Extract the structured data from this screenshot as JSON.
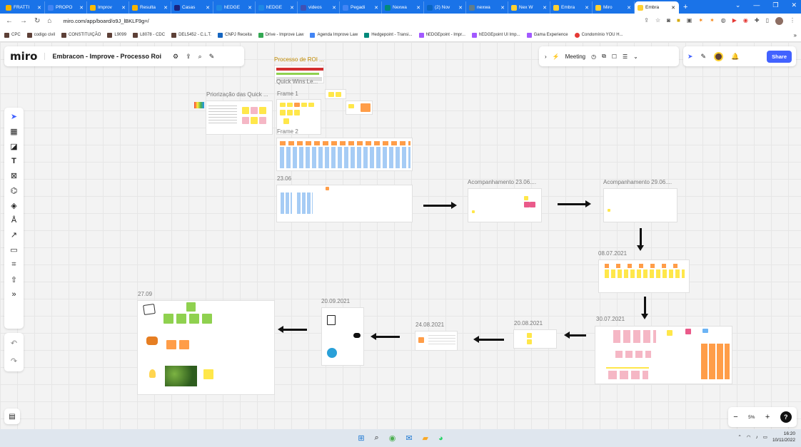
{
  "browser": {
    "tabs": [
      {
        "label": "FRATTI",
        "color": "#f4b400"
      },
      {
        "label": "PROPO",
        "color": "#4285f4"
      },
      {
        "label": "Improv",
        "color": "#fbbc04"
      },
      {
        "label": "Resulta",
        "color": "#f4b400"
      },
      {
        "label": "Casas",
        "color": "#1a237e"
      },
      {
        "label": "hEDGE",
        "color": "#1e88e5"
      },
      {
        "label": "hEDGE",
        "color": "#1e88e5"
      },
      {
        "label": "videos",
        "color": "#3f51b5"
      },
      {
        "label": "Pegadi",
        "color": "#4285f4"
      },
      {
        "label": "Nexwa",
        "color": "#00897b"
      },
      {
        "label": "(2) Nov",
        "color": "#0a66c2"
      },
      {
        "label": "nexwa",
        "color": "#607d8b"
      },
      {
        "label": "Nex W",
        "color": "#ffd02f"
      },
      {
        "label": "Embra",
        "color": "#ffd02f"
      },
      {
        "label": "Miro",
        "color": "#ffd02f"
      },
      {
        "label": "Embra",
        "color": "#ffd02f"
      }
    ],
    "url": "miro.com/app/board/o9J_lBKLF9g=/",
    "bookmarks": [
      "CPC",
      "codigo civil",
      "CONSTITUIÇÃO",
      "L9099",
      "L8078 - CDC",
      "DEL5452 - C.L.T.",
      "CNPJ Receita",
      "Drive - Improve Law",
      "Agenda Improve Law",
      "Hedgepoint - Transi...",
      "hEDGEpoint - Impr...",
      "hEDGEpoint UI Imp...",
      "Gama Experience",
      "Condomínio YOU H..."
    ]
  },
  "board": {
    "logo": "miro",
    "name": "Embracon - Improve - Processo Roi",
    "meeting_label": "Meeting",
    "share_label": "Share",
    "zoom": "5%"
  },
  "frames": {
    "processo": "Processo de ROI ...",
    "quickwins": "Quick Wins Le...",
    "priorizacao": "Priorização das Quick ...",
    "frame1": "Frame 1",
    "frame2": "Frame 2",
    "f2306": "23.06",
    "acomp2306": "Acompanhamento 23.06....",
    "acomp2906": "Acompanhamento 29.06....",
    "f0807": "08.07.2021",
    "f3007": "30.07.2021",
    "f2008": "20.08.2021",
    "f2408": "24.08.2021",
    "f2009": "20.09.2021",
    "f2709": "27.09"
  },
  "taskbar": {
    "time": "16:20",
    "date": "10/11/2022"
  },
  "colors": {
    "accent": "#4262ff",
    "chrome": "#1a73e8",
    "sticky_yellow": "#ffe74a",
    "sticky_orange": "#ff9d48",
    "sticky_pink": "#f5b7c5"
  }
}
